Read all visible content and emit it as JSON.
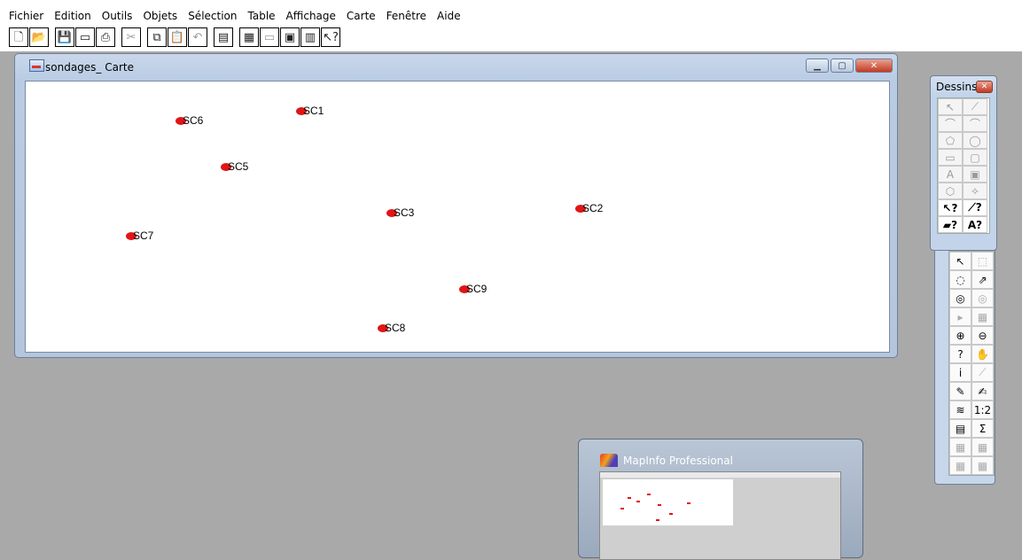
{
  "menu": [
    "Fichier",
    "Edition",
    "Outils",
    "Objets",
    "Sélection",
    "Table",
    "Affichage",
    "Carte",
    "Fenêtre",
    "Aide"
  ],
  "toolbar": {
    "buttons": [
      {
        "icon": "new-document-icon",
        "glyph": "🗋",
        "enabled": true
      },
      {
        "icon": "open-folder-icon",
        "glyph": "📂",
        "enabled": true
      },
      {
        "icon": "save-icon",
        "glyph": "💾",
        "enabled": false
      },
      {
        "icon": "window-icon",
        "glyph": "▭",
        "enabled": true
      },
      {
        "icon": "print-icon",
        "glyph": "⎙",
        "enabled": true
      },
      {
        "icon": "cut-icon",
        "glyph": "✂",
        "enabled": false
      },
      {
        "icon": "copy-icon",
        "glyph": "⧉",
        "enabled": true
      },
      {
        "icon": "paste-icon",
        "glyph": "📋",
        "enabled": false
      },
      {
        "icon": "undo-icon",
        "glyph": "↶",
        "enabled": false
      },
      {
        "icon": "browser-window-icon",
        "glyph": "▤",
        "enabled": true
      },
      {
        "icon": "map-window-icon",
        "glyph": "▦",
        "enabled": true
      },
      {
        "icon": "graph-window-icon",
        "glyph": "▭",
        "enabled": false
      },
      {
        "icon": "layout-window-icon",
        "glyph": "▣",
        "enabled": true
      },
      {
        "icon": "redistrict-window-icon",
        "glyph": "▥",
        "enabled": true
      },
      {
        "icon": "help-pointer-icon",
        "glyph": "↖?",
        "enabled": true
      }
    ]
  },
  "map_window": {
    "title": "sondages_ Carte",
    "points": [
      {
        "label": "SC1"
      },
      {
        "label": "SC6"
      },
      {
        "label": "SC5"
      },
      {
        "label": "SC3"
      },
      {
        "label": "SC2"
      },
      {
        "label": "SC7"
      },
      {
        "label": "SC9"
      },
      {
        "label": "SC8"
      }
    ]
  },
  "dessins": {
    "title": "Dessins",
    "tools": [
      [
        "↖",
        "⟋"
      ],
      [
        "⌒",
        "⌒"
      ],
      [
        "⬠",
        "◯"
      ],
      [
        "▭",
        "▢"
      ],
      [
        "A",
        "▣"
      ],
      [
        "⬡",
        "⟡"
      ],
      [
        "↖?",
        "⟋?"
      ],
      [
        "▰?",
        "A?"
      ]
    ]
  },
  "outils": {
    "tools": [
      [
        "↖",
        "⬚"
      ],
      [
        "◌",
        "⇗"
      ],
      [
        "◎",
        "◎"
      ],
      [
        "▸",
        "▦"
      ],
      [
        "⊕",
        "⊖"
      ],
      [
        "?",
        "✋"
      ],
      [
        "i",
        "⟋"
      ],
      [
        "✎",
        "✍"
      ],
      [
        "≋",
        "1:2"
      ],
      [
        "▤",
        "Σ"
      ],
      [
        "▦",
        "▦"
      ],
      [
        "▦",
        "▦"
      ]
    ]
  },
  "thumbnail": {
    "title": "MapInfo Professional"
  }
}
